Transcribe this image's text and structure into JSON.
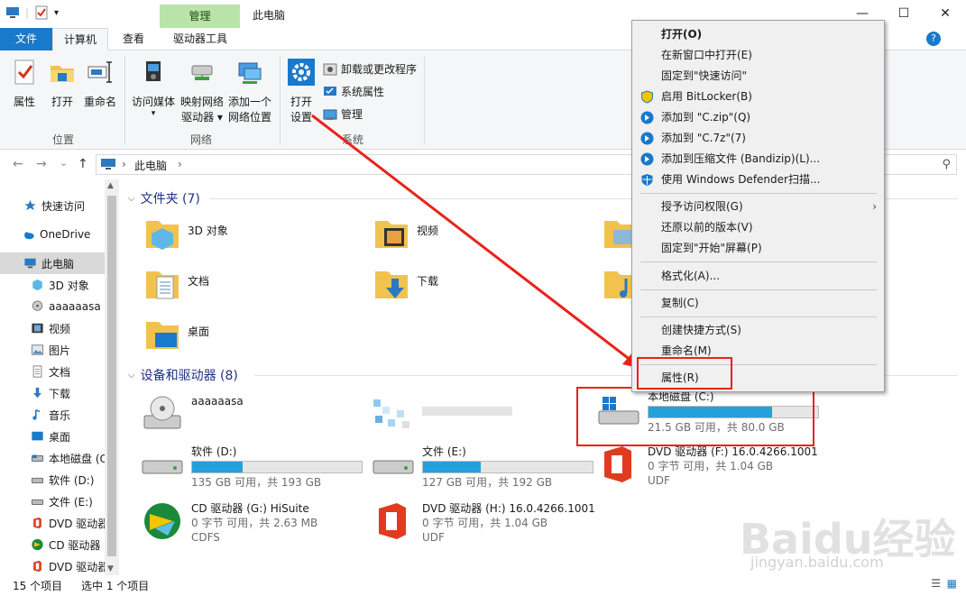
{
  "window": {
    "title": "此电脑",
    "contextual_tab": "管理",
    "controls": {
      "minimize": "—",
      "maximize": "☐",
      "close": "✕"
    }
  },
  "ribbon_tabs": [
    "文件",
    "计算机",
    "查看",
    "驱动器工具"
  ],
  "ribbon": {
    "location_group": {
      "label": "位置",
      "buttons": [
        "属性",
        "打开",
        "重命名"
      ]
    },
    "network_group": {
      "label": "网络",
      "buttons": [
        [
          "访问媒体"
        ],
        [
          "映射网络",
          "驱动器 ▾"
        ],
        [
          "添加一个",
          "网络位置"
        ]
      ]
    },
    "system_group": {
      "label": "系统",
      "open_settings": [
        "打开",
        "设置"
      ],
      "small_buttons": [
        "卸载或更改程序",
        "系统属性",
        "管理"
      ]
    }
  },
  "address": {
    "crumb": "此电脑",
    "back": "←",
    "forward": "→",
    "recent": "⌄",
    "up": "↑",
    "sep": "›",
    "search": "⚲"
  },
  "nav_pane": [
    {
      "label": "快速访问",
      "icon": "star-icon"
    },
    {
      "label": "OneDrive",
      "icon": "cloud-icon"
    },
    {
      "label": "此电脑",
      "icon": "pc-icon"
    },
    {
      "label": "3D 对象",
      "icon": "cube-icon"
    },
    {
      "label": "aaaaaasa",
      "icon": "cd-drive-icon"
    },
    {
      "label": "视频",
      "icon": "video-icon"
    },
    {
      "label": "图片",
      "icon": "picture-icon"
    },
    {
      "label": "文档",
      "icon": "document-icon"
    },
    {
      "label": "下载",
      "icon": "download-icon"
    },
    {
      "label": "音乐",
      "icon": "music-icon"
    },
    {
      "label": "桌面",
      "icon": "desktop-icon"
    },
    {
      "label": "本地磁盘 (C",
      "icon": "drive-icon"
    },
    {
      "label": "软件 (D:)",
      "icon": "drive-icon"
    },
    {
      "label": "文件 (E:)",
      "icon": "drive-icon"
    },
    {
      "label": "DVD 驱动器",
      "icon": "office-icon"
    },
    {
      "label": "CD 驱动器",
      "icon": "hisuite-icon"
    },
    {
      "label": "DVD 驱动器",
      "icon": "office-icon"
    }
  ],
  "folders_section": {
    "title": "文件夹 (7)"
  },
  "folders": [
    {
      "name": "3D 对象",
      "icon": "cube-folder-icon"
    },
    {
      "name": "视频",
      "icon": "video-folder-icon"
    },
    {
      "name": "",
      "icon": "picture-folder-icon"
    },
    {
      "name": "文档",
      "icon": "document-folder-icon"
    },
    {
      "name": "下载",
      "icon": "download-folder-icon"
    },
    {
      "name": "",
      "icon": "music-folder-icon"
    },
    {
      "name": "桌面",
      "icon": "desktop-folder-icon"
    }
  ],
  "drives_section": {
    "title": "设备和驱动器 (8)"
  },
  "drives": [
    {
      "name": "aaaaaasa",
      "icon": "cd-drive-icon"
    },
    {
      "name": "",
      "icon": "blurred-icon"
    },
    {
      "name": "本地磁盘 (C:)",
      "used_fraction": 0.73,
      "detail": "21.5 GB 可用，共 80.0 GB",
      "icon": "windows-drive-icon"
    },
    {
      "name": "软件 (D:)",
      "used_fraction": 0.3,
      "detail": "135 GB 可用，共 193 GB",
      "icon": "drive-icon"
    },
    {
      "name": "文件 (E:)",
      "used_fraction": 0.34,
      "detail": "127 GB 可用，共 192 GB",
      "icon": "drive-icon"
    },
    {
      "name": "DVD 驱动器 (F:) 16.0.4266.1001",
      "detail": "0 字节 可用，共 1.04 GB",
      "fs": "UDF",
      "icon": "office-icon"
    },
    {
      "name": "CD 驱动器 (G:) HiSuite",
      "detail": "0 字节 可用，共 2.63 MB",
      "fs": "CDFS",
      "icon": "hisuite-icon"
    },
    {
      "name": "DVD 驱动器 (H:) 16.0.4266.1001",
      "detail": "0 字节 可用，共 1.04 GB",
      "fs": "UDF",
      "icon": "office-icon"
    }
  ],
  "status": {
    "items": "15 个项目",
    "selected": "选中 1 个项目"
  },
  "context_menu": [
    {
      "label": "打开(O)",
      "bold": true
    },
    {
      "label": "在新窗口中打开(E)"
    },
    {
      "label": "固定到\"快速访问\""
    },
    {
      "label": "启用 BitLocker(B)",
      "icon": "shield-icon"
    },
    {
      "label": "添加到 \"C.zip\"(Q)",
      "icon": "bandizip-icon"
    },
    {
      "label": "添加到 \"C.7z\"(7)",
      "icon": "bandizip-icon"
    },
    {
      "label": "添加到压缩文件 (Bandizip)(L)...",
      "icon": "bandizip-icon"
    },
    {
      "label": "使用 Windows Defender扫描...",
      "icon": "defender-icon"
    },
    {
      "label": "授予访问权限(G)",
      "submenu": true
    },
    {
      "label": "还原以前的版本(V)"
    },
    {
      "label": "固定到\"开始\"屏幕(P)"
    },
    {
      "label": "格式化(A)..."
    },
    {
      "label": "复制(C)"
    },
    {
      "label": "创建快捷方式(S)"
    },
    {
      "label": "重命名(M)"
    },
    {
      "label": "属性(R)"
    }
  ],
  "watermark": {
    "text": "Baidu经验",
    "sub": "jingyan.baidu.com"
  },
  "colors": {
    "accent": "#1979ca",
    "manage_tab": "#b9e3a8",
    "annotation": "#e8231c",
    "drive_bar": "#26a0da"
  }
}
